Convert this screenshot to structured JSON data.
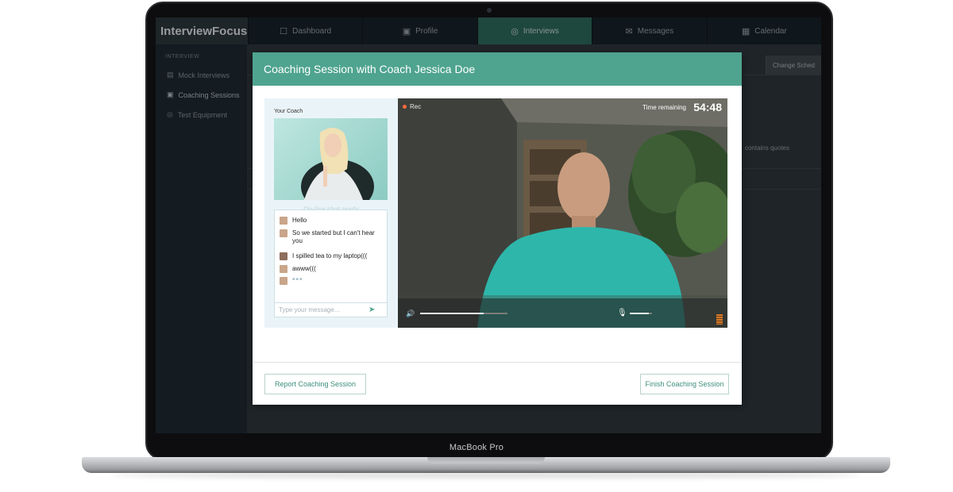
{
  "device": {
    "label": "MacBook Pro"
  },
  "app": {
    "logo": "InterviewFocus",
    "nav": [
      {
        "label": "Dashboard",
        "icon": "dashboard-icon"
      },
      {
        "label": "Profile",
        "icon": "profile-icon"
      },
      {
        "label": "Interviews",
        "icon": "interviews-icon",
        "active": true
      },
      {
        "label": "Messages",
        "icon": "messages-icon"
      },
      {
        "label": "Calendar",
        "icon": "calendar-icon"
      }
    ],
    "sidebar": {
      "section": "INTERVIEW",
      "items": [
        {
          "label": "Mock Interviews"
        },
        {
          "label": "Coaching Sessions",
          "active": true
        },
        {
          "label": "Test Equipment"
        }
      ]
    },
    "main": {
      "button_label": "Change Sched",
      "note": "contains quotes"
    }
  },
  "modal": {
    "title": "Coaching Session with Coach Jessica Doe",
    "coach": {
      "label": "Your Coach",
      "chat_ready": "On-line chat ready",
      "messages": [
        {
          "from": "coach",
          "text": "Hello"
        },
        {
          "from": "coach",
          "text": "So we started but I can't hear you"
        },
        {
          "from": "user",
          "text": "I spilled tea to my laptop((("
        },
        {
          "from": "coach",
          "text": "awww((("
        },
        {
          "from": "coach",
          "text": "•••"
        }
      ],
      "input_placeholder": "Type your message..."
    },
    "video": {
      "rec_label": "Rec",
      "time_label": "Time remaining",
      "time_value": "54:48",
      "volume_level": 0.73,
      "mic_level": 0.85
    },
    "footer": {
      "report_label": "Report Coaching Session",
      "finish_label": "Finish Coaching Session"
    }
  },
  "colors": {
    "accent": "#4fa48f",
    "header_dark": "#17232c",
    "rec_dot": "#ff6b3a"
  }
}
